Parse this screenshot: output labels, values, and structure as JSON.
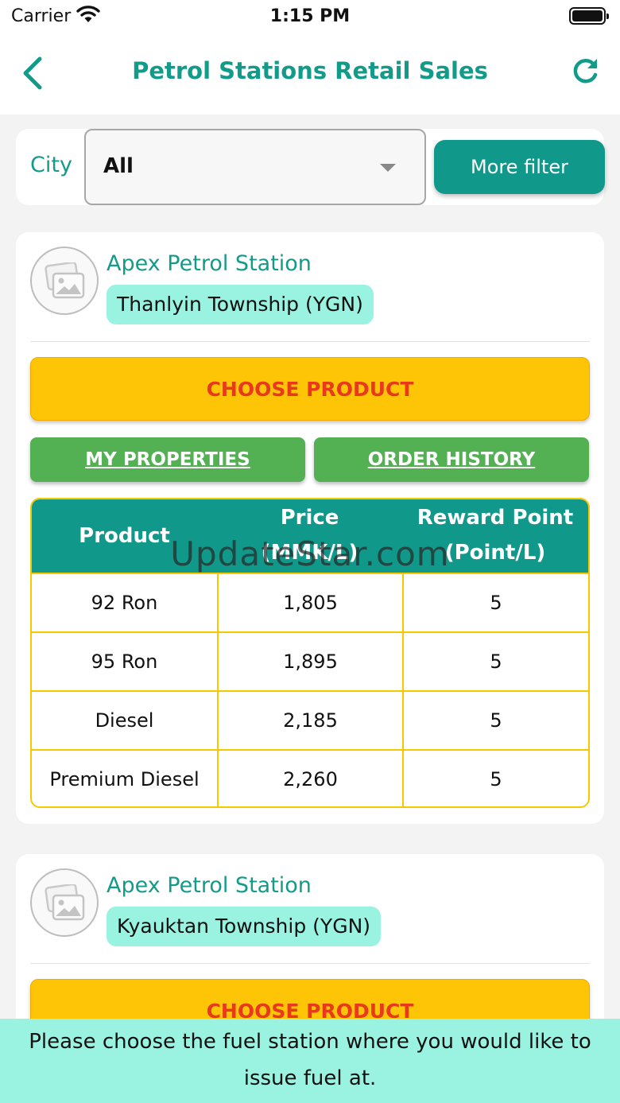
{
  "status_bar": {
    "carrier": "Carrier",
    "time": "1:15 PM"
  },
  "header": {
    "title": "Petrol Stations Retail Sales",
    "back_icon": "chevron-left-icon",
    "refresh_icon": "refresh-icon"
  },
  "filter": {
    "city_label": "City",
    "city_value": "All",
    "more_filter_label": "More filter"
  },
  "stations": [
    {
      "name": "Apex Petrol Station",
      "township": "Thanlyin Township (YGN)",
      "choose_label": "CHOOSE PRODUCT",
      "properties_label": "MY PROPERTIES",
      "history_label": "ORDER HISTORY",
      "table": {
        "headers": {
          "product": "Product",
          "price_1": "Price",
          "price_2": "(MMK/L)",
          "reward_1": "Reward Point",
          "reward_2": "(Point/L)"
        },
        "rows": [
          {
            "product": "92 Ron",
            "price": "1,805",
            "reward": "5"
          },
          {
            "product": "95 Ron",
            "price": "1,895",
            "reward": "5"
          },
          {
            "product": "Diesel",
            "price": "2,185",
            "reward": "5"
          },
          {
            "product": "Premium Diesel",
            "price": "2,260",
            "reward": "5"
          }
        ]
      }
    },
    {
      "name": "Apex Petrol Station",
      "township": "Kyauktan Township (YGN)",
      "choose_label": "CHOOSE PRODUCT"
    }
  ],
  "watermark": "UpdateStar.com",
  "hint": {
    "line1": "Please choose the fuel station where you would like to",
    "line2": "issue fuel at."
  },
  "colors": {
    "accent": "#10988a",
    "title": "#139b8a",
    "choose": "#fec507",
    "choose_text": "#e8391c",
    "green": "#53b154",
    "badge": "#9af3e1",
    "table_border": "#f5c800"
  }
}
